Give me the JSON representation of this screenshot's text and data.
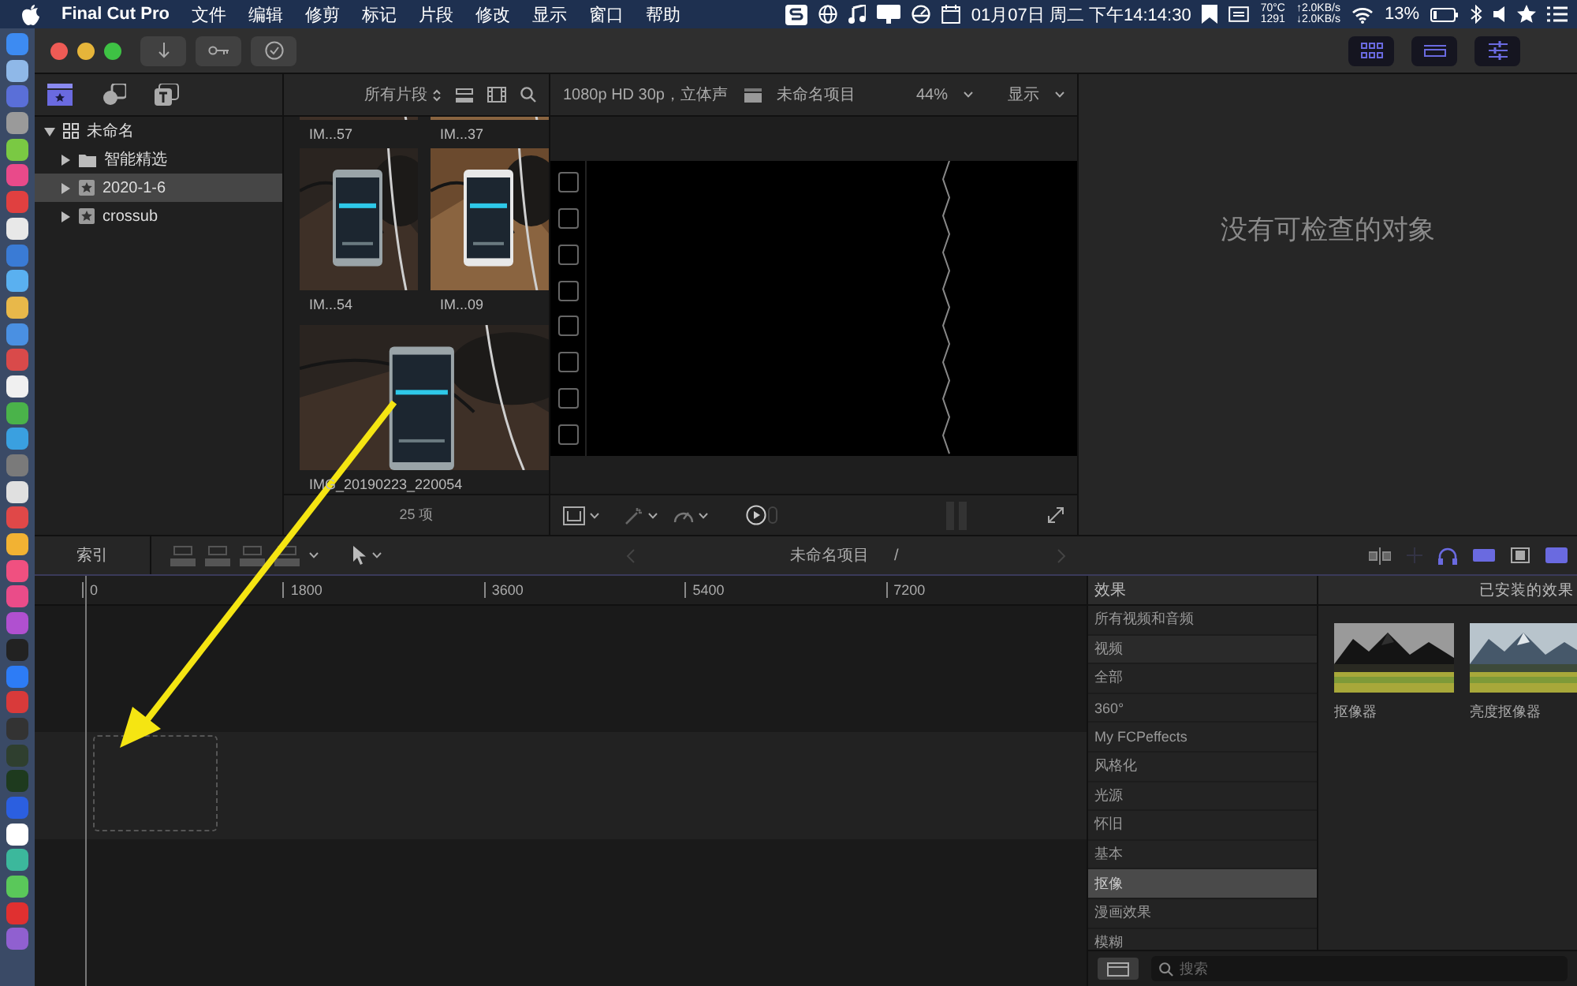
{
  "menu_bar": {
    "app_name": "Final Cut Pro",
    "menus": [
      "文件",
      "编辑",
      "修剪",
      "标记",
      "片段",
      "修改",
      "显示",
      "窗口",
      "帮助"
    ],
    "clock": "01月07日 周二 下午14:14:30",
    "temperature": "70°C",
    "fan_speed": "1291",
    "upload": "↑2.0KB/s",
    "download": "↓2.0KB/s",
    "battery": "13%"
  },
  "libraries": [
    {
      "label": "未命名",
      "kind": "library",
      "expanded": true,
      "selected": false,
      "children": [
        {
          "label": "智能精选",
          "kind": "folder",
          "expanded": false,
          "selected": false
        },
        {
          "label": "2020-1-6",
          "kind": "event",
          "expanded": false,
          "selected": true
        },
        {
          "label": "crossub",
          "kind": "event",
          "expanded": false,
          "selected": false
        }
      ]
    }
  ],
  "browser": {
    "filter": "所有片段",
    "clips": [
      {
        "name": "IM...57",
        "kind": "small"
      },
      {
        "name": "IM...37",
        "kind": "small"
      },
      {
        "name": "IM...54",
        "kind": "small"
      },
      {
        "name": "IM...09",
        "kind": "small"
      },
      {
        "name": "IMG_20190223_220054",
        "kind": "wide"
      }
    ],
    "item_count": "25 项"
  },
  "viewer": {
    "format": "1080p HD 30p，立体声",
    "project": "未命名项目",
    "zoom": "44%",
    "view_menu": "显示"
  },
  "inspector": {
    "empty_message": "没有可检查的对象"
  },
  "timeline": {
    "index_button": "索引",
    "project": "未命名项目",
    "separator": "/",
    "ruler": [
      "0",
      "1800",
      "3600",
      "5400",
      "7200"
    ]
  },
  "effects": {
    "header": "效果",
    "installed_title": "已安装的效果",
    "categories": [
      {
        "label": "所有视频和音频",
        "kind": "category",
        "selected": false
      },
      {
        "label": "视频",
        "kind": "section",
        "selected": false
      },
      {
        "label": "全部",
        "kind": "category",
        "selected": false
      },
      {
        "label": "360°",
        "kind": "category",
        "selected": false
      },
      {
        "label": "My FCPeffects",
        "kind": "category",
        "selected": false
      },
      {
        "label": "风格化",
        "kind": "category",
        "selected": false
      },
      {
        "label": "光源",
        "kind": "category",
        "selected": false
      },
      {
        "label": "怀旧",
        "kind": "category",
        "selected": false
      },
      {
        "label": "基本",
        "kind": "category",
        "selected": false
      },
      {
        "label": "抠像",
        "kind": "category",
        "selected": true
      },
      {
        "label": "漫画效果",
        "kind": "category",
        "selected": false
      },
      {
        "label": "模糊",
        "kind": "category",
        "selected": false
      }
    ],
    "items": [
      {
        "label": "抠像器"
      },
      {
        "label": "亮度抠像器"
      }
    ],
    "search": {
      "placeholder": "搜索"
    }
  }
}
